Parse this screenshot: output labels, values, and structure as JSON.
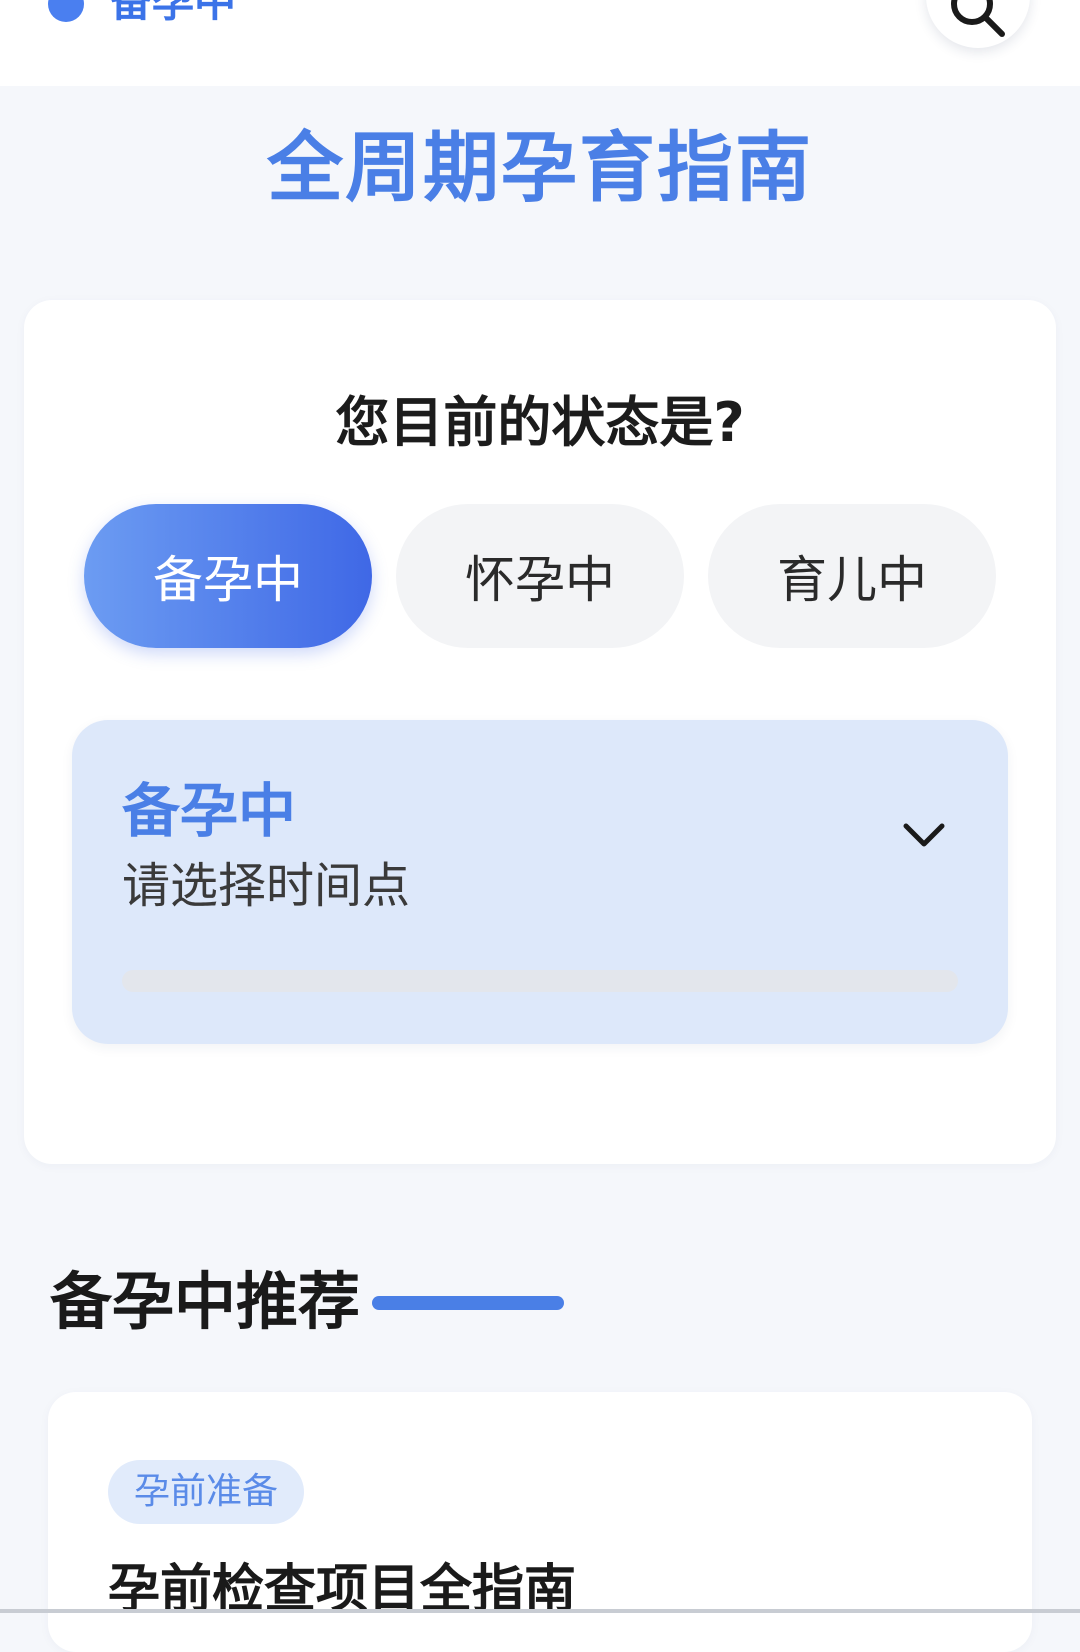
{
  "header": {
    "current_status": "备孕中",
    "search_icon": "search-icon",
    "accent_color": "#4a7fe6"
  },
  "page_title": "全周期孕育指南",
  "status_selector": {
    "question": "您目前的状态是?",
    "options": [
      {
        "label": "备孕中",
        "selected": true
      },
      {
        "label": "怀孕中",
        "selected": false
      },
      {
        "label": "育儿中",
        "selected": false
      }
    ]
  },
  "time_picker": {
    "stage": "备孕中",
    "hint": "请选择时间点",
    "progress": 0,
    "expand_icon": "chevron-down-icon"
  },
  "recommend": {
    "title": "备孕中推荐",
    "articles": [
      {
        "tag": "孕前准备",
        "title": "孕前检查项目全指南"
      }
    ]
  }
}
